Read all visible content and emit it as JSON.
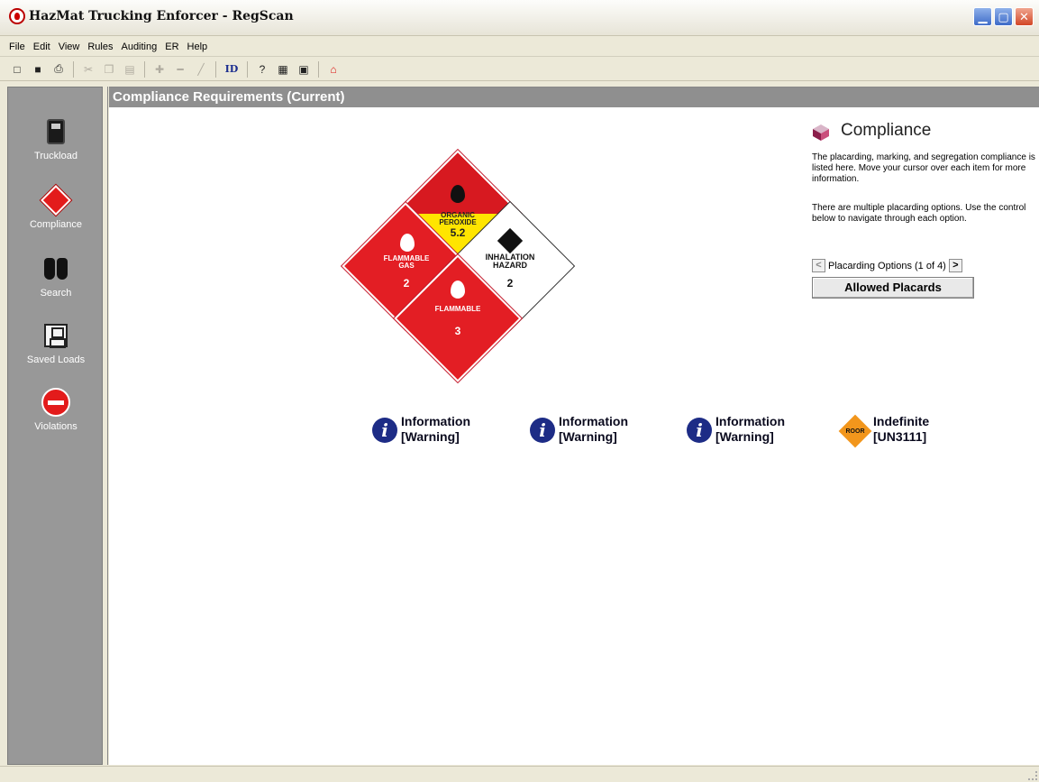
{
  "window": {
    "title": "HazMat Trucking Enforcer - RegScan"
  },
  "menu": [
    "File",
    "Edit",
    "View",
    "Rules",
    "Auditing",
    "ER",
    "Help"
  ],
  "toolbar": {
    "id_label": "ID"
  },
  "nav": {
    "items": [
      {
        "label": "Truckload",
        "icon": "truck-icon"
      },
      {
        "label": "Compliance",
        "icon": "hazmat-diamond-icon"
      },
      {
        "label": "Search",
        "icon": "binoculars-icon"
      },
      {
        "label": "Saved Loads",
        "icon": "floppy-disk-icon"
      },
      {
        "label": "Violations",
        "icon": "no-entry-icon"
      }
    ]
  },
  "main": {
    "header": "Compliance Requirements (Current)",
    "placards": {
      "top": {
        "line1": "ORGANIC",
        "line2": "PEROXIDE",
        "class": "5.2"
      },
      "left": {
        "line1": "FLAMMABLE",
        "line2": "GAS",
        "class": "2"
      },
      "right": {
        "line1": "INHALATION",
        "line2": "HAZARD",
        "class": "2"
      },
      "bottom": {
        "line1": "FLAMMABLE",
        "class": "3"
      }
    },
    "info_items": [
      {
        "title": "Information",
        "sub": "[Warning]"
      },
      {
        "title": "Information",
        "sub": "[Warning]"
      },
      {
        "title": "Information",
        "sub": "[Warning]"
      },
      {
        "title": "Indefinite",
        "sub": "[UN3111]",
        "badge": "ROOR"
      }
    ]
  },
  "panel": {
    "title": "Compliance",
    "p1": "The placarding, marking, and segregation compliance is listed here. Move your cursor over each item for more information.",
    "p2": "There are multiple placarding options. Use the control below to navigate through each option.",
    "pager_label": "Placarding Options (1 of 4)",
    "prev": "<",
    "next": ">",
    "button": "Allowed Placards"
  },
  "colors": {
    "header_bg": "#8f8f8f",
    "nav_bg": "#989898",
    "placard_red": "#e31e24",
    "info_blue": "#1d2c86"
  }
}
